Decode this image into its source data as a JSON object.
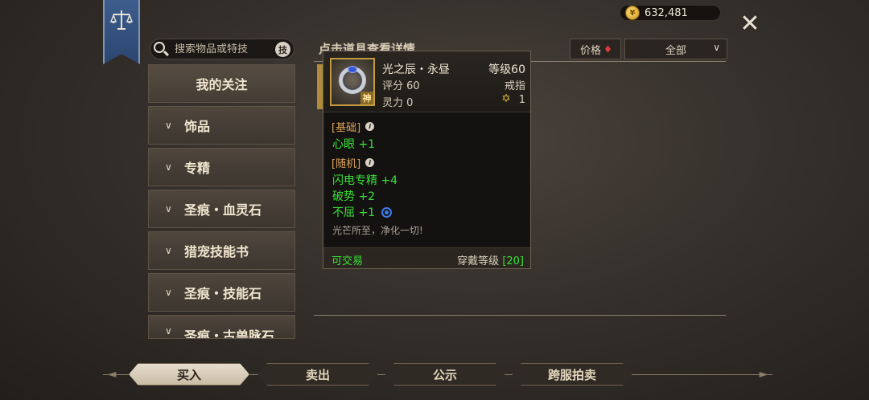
{
  "gold": {
    "amount": "632,481"
  },
  "search": {
    "placeholder": "搜索物品或特技",
    "skill_button": "技"
  },
  "sidebar": {
    "favorites": "我的关注",
    "items": [
      {
        "label": "饰品"
      },
      {
        "label": "专精"
      },
      {
        "label": "圣痕・血灵石"
      },
      {
        "label": "猎宠技能书"
      },
      {
        "label": "圣痕・技能石"
      },
      {
        "label": "圣痕・古兽脉石"
      }
    ]
  },
  "header": {
    "title": "点击道具查看详情",
    "price_label": "价格",
    "filter_value": "全部"
  },
  "tooltip": {
    "name": "光之辰・永昼",
    "level": "等级60",
    "score": "评分 60",
    "slot": "戒指",
    "spirit": "灵力 0",
    "star_count": "1",
    "god_mark": "神",
    "base_title": "[基础]",
    "base_stats": [
      "心眼 +1"
    ],
    "random_title": "[随机]",
    "random_stats": [
      "闪电专精 +4",
      "破势 +2",
      "不屈 +1"
    ],
    "flavor": "光芒所至，净化一切!",
    "tradeable": "可交易",
    "wear_level_label": "穿戴等级",
    "wear_level_value": "[20]"
  },
  "bottom_tabs": [
    {
      "label": "买入"
    },
    {
      "label": "卖出"
    },
    {
      "label": "公示"
    },
    {
      "label": "跨服拍卖"
    }
  ],
  "colors": {
    "stat_green": "#35e235",
    "section_orange": "#e0a458",
    "banner_blue": "#3d5d8c"
  }
}
